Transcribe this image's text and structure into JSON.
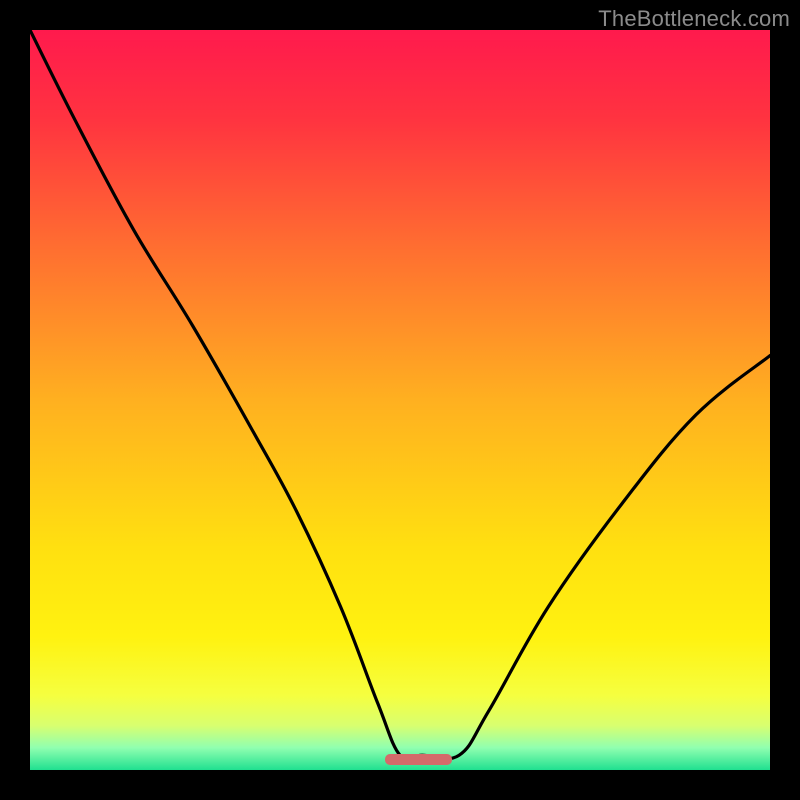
{
  "watermark": "TheBottleneck.com",
  "colors": {
    "gradient_stops": [
      {
        "pos": 0.0,
        "color": "#ff1a4d"
      },
      {
        "pos": 0.12,
        "color": "#ff3340"
      },
      {
        "pos": 0.3,
        "color": "#ff7030"
      },
      {
        "pos": 0.5,
        "color": "#ffb020"
      },
      {
        "pos": 0.7,
        "color": "#ffe010"
      },
      {
        "pos": 0.82,
        "color": "#fff210"
      },
      {
        "pos": 0.9,
        "color": "#f5ff40"
      },
      {
        "pos": 0.94,
        "color": "#d8ff70"
      },
      {
        "pos": 0.97,
        "color": "#90ffb0"
      },
      {
        "pos": 1.0,
        "color": "#20e090"
      }
    ],
    "curve": "#000000",
    "marker": "#d46a6a",
    "background": "#000000"
  },
  "marker": {
    "x_frac": 0.525,
    "width_frac": 0.09,
    "y_frac": 0.985
  },
  "chart_data": {
    "type": "line",
    "title": "",
    "xlabel": "",
    "ylabel": "",
    "xlim": [
      0,
      1
    ],
    "ylim": [
      0,
      1
    ],
    "series": [
      {
        "name": "bottleneck-curve",
        "x": [
          0.0,
          0.06,
          0.14,
          0.22,
          0.3,
          0.36,
          0.42,
          0.47,
          0.5,
          0.53,
          0.58,
          0.62,
          0.7,
          0.8,
          0.9,
          1.0
        ],
        "y": [
          1.0,
          0.88,
          0.73,
          0.6,
          0.46,
          0.35,
          0.22,
          0.09,
          0.02,
          0.02,
          0.02,
          0.08,
          0.22,
          0.36,
          0.48,
          0.56
        ]
      }
    ],
    "annotations": [
      {
        "text": "TheBottleneck.com",
        "role": "watermark",
        "position": "top-right"
      }
    ],
    "note": "Optimal region marked near x≈0.48–0.57 at y≈0"
  }
}
